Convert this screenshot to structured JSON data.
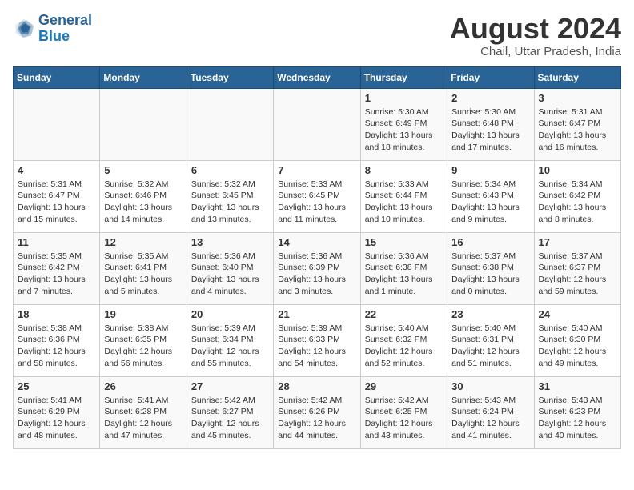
{
  "header": {
    "logo_line1": "General",
    "logo_line2": "Blue",
    "month_title": "August 2024",
    "location": "Chail, Uttar Pradesh, India"
  },
  "weekdays": [
    "Sunday",
    "Monday",
    "Tuesday",
    "Wednesday",
    "Thursday",
    "Friday",
    "Saturday"
  ],
  "weeks": [
    [
      {
        "day": "",
        "info": ""
      },
      {
        "day": "",
        "info": ""
      },
      {
        "day": "",
        "info": ""
      },
      {
        "day": "",
        "info": ""
      },
      {
        "day": "1",
        "info": "Sunrise: 5:30 AM\nSunset: 6:49 PM\nDaylight: 13 hours\nand 18 minutes."
      },
      {
        "day": "2",
        "info": "Sunrise: 5:30 AM\nSunset: 6:48 PM\nDaylight: 13 hours\nand 17 minutes."
      },
      {
        "day": "3",
        "info": "Sunrise: 5:31 AM\nSunset: 6:47 PM\nDaylight: 13 hours\nand 16 minutes."
      }
    ],
    [
      {
        "day": "4",
        "info": "Sunrise: 5:31 AM\nSunset: 6:47 PM\nDaylight: 13 hours\nand 15 minutes."
      },
      {
        "day": "5",
        "info": "Sunrise: 5:32 AM\nSunset: 6:46 PM\nDaylight: 13 hours\nand 14 minutes."
      },
      {
        "day": "6",
        "info": "Sunrise: 5:32 AM\nSunset: 6:45 PM\nDaylight: 13 hours\nand 13 minutes."
      },
      {
        "day": "7",
        "info": "Sunrise: 5:33 AM\nSunset: 6:45 PM\nDaylight: 13 hours\nand 11 minutes."
      },
      {
        "day": "8",
        "info": "Sunrise: 5:33 AM\nSunset: 6:44 PM\nDaylight: 13 hours\nand 10 minutes."
      },
      {
        "day": "9",
        "info": "Sunrise: 5:34 AM\nSunset: 6:43 PM\nDaylight: 13 hours\nand 9 minutes."
      },
      {
        "day": "10",
        "info": "Sunrise: 5:34 AM\nSunset: 6:42 PM\nDaylight: 13 hours\nand 8 minutes."
      }
    ],
    [
      {
        "day": "11",
        "info": "Sunrise: 5:35 AM\nSunset: 6:42 PM\nDaylight: 13 hours\nand 7 minutes."
      },
      {
        "day": "12",
        "info": "Sunrise: 5:35 AM\nSunset: 6:41 PM\nDaylight: 13 hours\nand 5 minutes."
      },
      {
        "day": "13",
        "info": "Sunrise: 5:36 AM\nSunset: 6:40 PM\nDaylight: 13 hours\nand 4 minutes."
      },
      {
        "day": "14",
        "info": "Sunrise: 5:36 AM\nSunset: 6:39 PM\nDaylight: 13 hours\nand 3 minutes."
      },
      {
        "day": "15",
        "info": "Sunrise: 5:36 AM\nSunset: 6:38 PM\nDaylight: 13 hours\nand 1 minute."
      },
      {
        "day": "16",
        "info": "Sunrise: 5:37 AM\nSunset: 6:38 PM\nDaylight: 13 hours\nand 0 minutes."
      },
      {
        "day": "17",
        "info": "Sunrise: 5:37 AM\nSunset: 6:37 PM\nDaylight: 12 hours\nand 59 minutes."
      }
    ],
    [
      {
        "day": "18",
        "info": "Sunrise: 5:38 AM\nSunset: 6:36 PM\nDaylight: 12 hours\nand 58 minutes."
      },
      {
        "day": "19",
        "info": "Sunrise: 5:38 AM\nSunset: 6:35 PM\nDaylight: 12 hours\nand 56 minutes."
      },
      {
        "day": "20",
        "info": "Sunrise: 5:39 AM\nSunset: 6:34 PM\nDaylight: 12 hours\nand 55 minutes."
      },
      {
        "day": "21",
        "info": "Sunrise: 5:39 AM\nSunset: 6:33 PM\nDaylight: 12 hours\nand 54 minutes."
      },
      {
        "day": "22",
        "info": "Sunrise: 5:40 AM\nSunset: 6:32 PM\nDaylight: 12 hours\nand 52 minutes."
      },
      {
        "day": "23",
        "info": "Sunrise: 5:40 AM\nSunset: 6:31 PM\nDaylight: 12 hours\nand 51 minutes."
      },
      {
        "day": "24",
        "info": "Sunrise: 5:40 AM\nSunset: 6:30 PM\nDaylight: 12 hours\nand 49 minutes."
      }
    ],
    [
      {
        "day": "25",
        "info": "Sunrise: 5:41 AM\nSunset: 6:29 PM\nDaylight: 12 hours\nand 48 minutes."
      },
      {
        "day": "26",
        "info": "Sunrise: 5:41 AM\nSunset: 6:28 PM\nDaylight: 12 hours\nand 47 minutes."
      },
      {
        "day": "27",
        "info": "Sunrise: 5:42 AM\nSunset: 6:27 PM\nDaylight: 12 hours\nand 45 minutes."
      },
      {
        "day": "28",
        "info": "Sunrise: 5:42 AM\nSunset: 6:26 PM\nDaylight: 12 hours\nand 44 minutes."
      },
      {
        "day": "29",
        "info": "Sunrise: 5:42 AM\nSunset: 6:25 PM\nDaylight: 12 hours\nand 43 minutes."
      },
      {
        "day": "30",
        "info": "Sunrise: 5:43 AM\nSunset: 6:24 PM\nDaylight: 12 hours\nand 41 minutes."
      },
      {
        "day": "31",
        "info": "Sunrise: 5:43 AM\nSunset: 6:23 PM\nDaylight: 12 hours\nand 40 minutes."
      }
    ]
  ]
}
